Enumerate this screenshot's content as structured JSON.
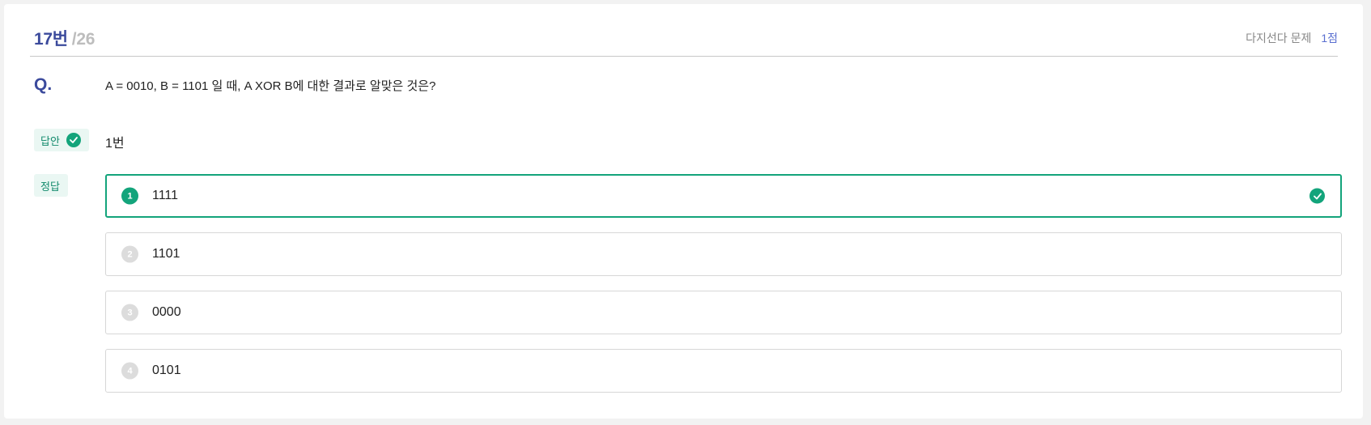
{
  "header": {
    "current_number": "17번",
    "total": "/26",
    "question_type": "다지선다 문제",
    "points": "1점"
  },
  "question": {
    "label": "Q.",
    "text": "A = 0010, B = 1101 일 때, A XOR B에 대한 결과로 알맞은 것은?"
  },
  "answer": {
    "tag_label": "답안",
    "value": "1번"
  },
  "correct": {
    "tag_label": "정답"
  },
  "options": [
    {
      "num": "1",
      "text": "1111",
      "selected": true
    },
    {
      "num": "2",
      "text": "1101",
      "selected": false
    },
    {
      "num": "3",
      "text": "0000",
      "selected": false
    },
    {
      "num": "4",
      "text": "0101",
      "selected": false
    }
  ],
  "colors": {
    "accent_green": "#13a47b",
    "title_blue": "#3b4a9c",
    "points_blue": "#5a6fd0"
  },
  "icons": {
    "answer_status": "check-circle-icon",
    "selected_option": "check-circle-icon"
  }
}
